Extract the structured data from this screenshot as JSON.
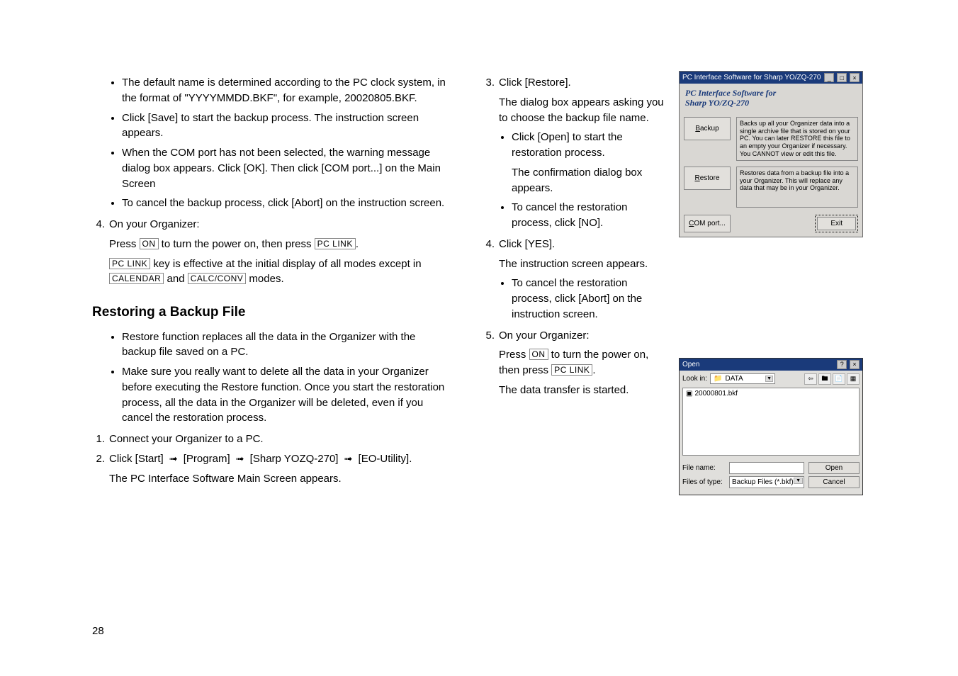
{
  "left": {
    "li_default_name": "The default name is determined according to the PC clock system, in the format of \"YYYYMMDD.BKF\", for example, 20020805.BKF.",
    "li_click_save": "Click [Save] to start the backup process. The instruction screen appears.",
    "li_com_port": "When the COM port has not been selected, the warning message dialog box appears. Click [OK]. Then click [COM port...] on the Main Screen",
    "li_cancel_backup": "To cancel the backup process, click [Abort] on the instruction screen.",
    "step4_label": "4.",
    "step4_text": "On your Organizer:",
    "press_on_pre": "Press ",
    "key_on": "ON",
    "press_on_mid": " to turn the power on, then press ",
    "key_pclink": "PC LINK",
    "press_on_end": ".",
    "pclink_effective_1": " key is effective at the initial display of all modes except in ",
    "key_calendar": "CALENDAR",
    "pclink_and": " and ",
    "key_calcconv": "CALC/CONV",
    "pclink_effective_2": " modes.",
    "heading_restoring": "Restoring a Backup File",
    "li_restore_replace": "Restore function replaces all the data in the Organizer with the backup file saved on a PC.",
    "li_make_sure": "Make sure you really want to delete all the data in your Organizer before executing the Restore function. Once you start the restoration process, all the data in the Organizer will be deleted, even if you cancel the restoration process.",
    "step1_label": "1.",
    "step1_text": "Connect your Organizer to a PC.",
    "step2_label": "2.",
    "step2_text_1": "Click [Start] ",
    "step2_text_2": " [Program] ",
    "step2_text_3": " [Sharp YOZQ-270] ",
    "step2_text_4": " [EO-Utility].",
    "step2_sub": "The PC Interface Software Main Screen appears."
  },
  "right": {
    "step3_label": "3.",
    "step3_text": "Click [Restore].",
    "step3_sub": "The dialog box appears asking you to choose the backup file name.",
    "step3_li_open": "Click [Open] to start the restoration process.",
    "step3_sub2": "The confirmation dialog box appears.",
    "step3_li_cancel": "To cancel the restoration process, click [NO].",
    "step4_label": "4.",
    "step4_text": "Click [YES].",
    "step4_sub": "The instruction screen appears.",
    "step4_li_cancel": "To cancel the restoration process, click [Abort] on the instruction screen.",
    "step5_label": "5.",
    "step5_text": "On your Organizer:",
    "step5_press_pre": "Press ",
    "step5_key_on": "ON",
    "step5_press_mid": " to turn the power on, then press ",
    "step5_key_pclink": "PC LINK",
    "step5_press_end": ".",
    "step5_sub2": "The data transfer is started."
  },
  "win1": {
    "title": "PC Interface Software for Sharp YO/ZQ-270",
    "header1_part1": "PC Interface Software for",
    "header1_part2": "Sharp YO/ZQ-270",
    "backup_label_u": "B",
    "backup_label": "ackup",
    "backup_desc": "Backs up all your Organizer data into a single archive file that is stored on your PC. You can later RESTORE this file to an empty your Organizer if necessary. You CANNOT view or edit this file.",
    "restore_label_u": "R",
    "restore_label": "estore",
    "restore_desc": "Restores data from a backup file into a your Organizer. This will replace any data that may be in your Organizer.",
    "comport_label_u": "C",
    "comport_label": "OM port...",
    "exit_label": "Exit",
    "min": "_",
    "max": "□",
    "close": "×"
  },
  "win2": {
    "title": "Open",
    "help": "?",
    "close": "×",
    "lookin_label": "Look in:",
    "lookin_value": "DATA",
    "icon_back": "⇦",
    "icon_up": "🖿",
    "icon_new": "📄",
    "icon_view": "▦",
    "file_entry": "20000801.bkf",
    "filename_label": "File name:",
    "filename_value": "",
    "filetype_label": "Files of type:",
    "filetype_value": "Backup Files (*.bkf)",
    "open_btn": "Open",
    "cancel_btn": "Cancel"
  },
  "page_number": "28"
}
